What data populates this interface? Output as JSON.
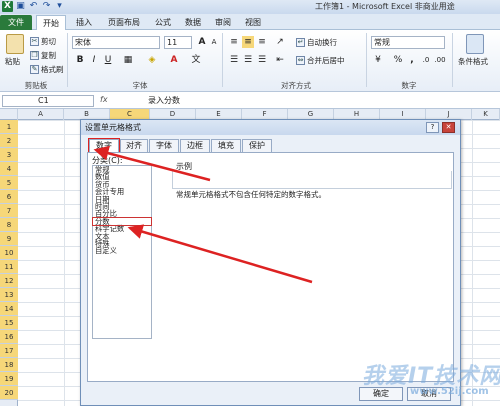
{
  "window": {
    "title": "工作簿1 - Microsoft Excel 非商业用途"
  },
  "tabs": [
    "文件",
    "开始",
    "插入",
    "页面布局",
    "公式",
    "数据",
    "审阅",
    "视图"
  ],
  "ribbon": {
    "clipboard": {
      "paste": "粘贴",
      "cut": "剪切",
      "copy": "复制",
      "format_painter": "格式刷",
      "label": "剪贴板"
    },
    "font": {
      "name": "宋体",
      "size": "11",
      "label": "字体",
      "bold": "B",
      "italic": "I",
      "underline": "U",
      "grow": "A",
      "shrink": "A",
      "font_color": "A"
    },
    "alignment": {
      "wrap": "自动换行",
      "merge": "合并后居中",
      "label": "对齐方式"
    },
    "number": {
      "format": "常规",
      "percent": "%",
      "comma": ",",
      "label": "数字"
    },
    "styles": {
      "conditional": "条件格式"
    }
  },
  "formula_bar": {
    "name_box": "C1",
    "fx": "fx",
    "value": "录入分数"
  },
  "columns": [
    "A",
    "B",
    "C",
    "D",
    "E",
    "F",
    "G",
    "H",
    "I",
    "J",
    "K"
  ],
  "rows": [
    "1",
    "2",
    "3",
    "4",
    "5",
    "6",
    "7",
    "8",
    "9",
    "10",
    "11",
    "12",
    "13",
    "14",
    "15",
    "16",
    "17",
    "18",
    "19",
    "20"
  ],
  "dialog": {
    "title": "设置单元格格式",
    "help": "?",
    "close": "✕",
    "tabs": [
      "数字",
      "对齐",
      "字体",
      "边框",
      "填充",
      "保护"
    ],
    "category_label": "分类(C):",
    "categories": [
      "常规",
      "数值",
      "货币",
      "会计专用",
      "日期",
      "时间",
      "百分比",
      "分数",
      "科学记数",
      "文本",
      "特殊",
      "自定义"
    ],
    "selected_category": "分数",
    "sample_label": "示例",
    "description": "常规单元格格式不包含任何特定的数字格式。",
    "ok": "确定",
    "cancel": "取消"
  },
  "watermark": {
    "text": "我爱IT技术网",
    "url": "www.52ij.com"
  },
  "colors": {
    "accent": "#2a7a3b",
    "selected_column": "#c7dbf3",
    "highlight": "#dd2222",
    "row_header_selected": "#f6d779"
  }
}
